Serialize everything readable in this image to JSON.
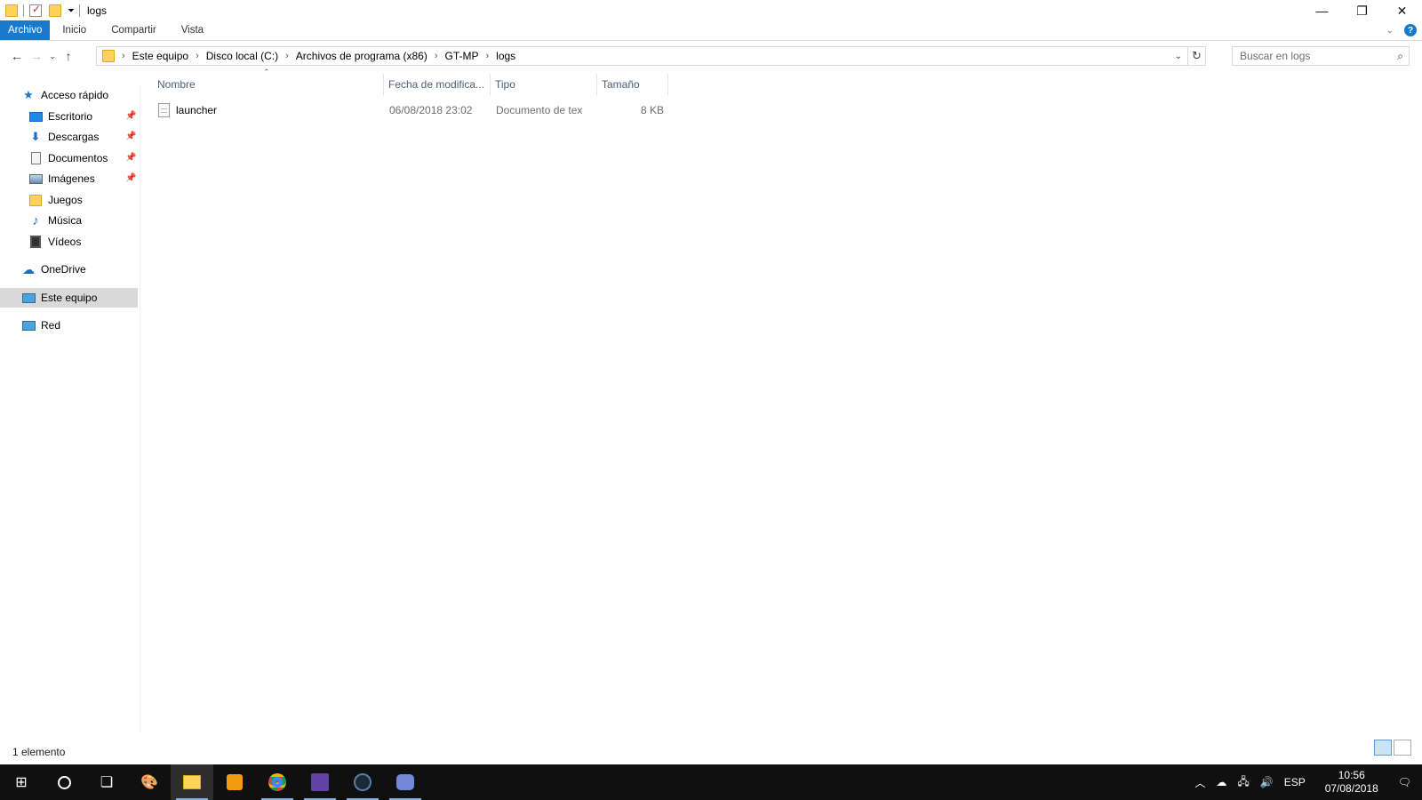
{
  "window": {
    "title": "logs",
    "controls": {
      "minimize": "—",
      "restore": "❐",
      "close": "✕"
    }
  },
  "ribbon": {
    "tabs": [
      "Archivo",
      "Inicio",
      "Compartir",
      "Vista"
    ],
    "accent": "#1979ca",
    "help_icon": "?"
  },
  "address_bar": {
    "breadcrumbs": [
      "Este equipo",
      "Disco local (C:)",
      "Archivos de programa (x86)",
      "GT-MP",
      "logs"
    ],
    "search_placeholder": "Buscar en logs"
  },
  "sidebar": {
    "items": [
      {
        "label": "Acceso rápido",
        "icon": "star-icon"
      },
      {
        "label": "Escritorio",
        "icon": "desktop-icon",
        "pinned": true
      },
      {
        "label": "Descargas",
        "icon": "download-icon",
        "pinned": true
      },
      {
        "label": "Documentos",
        "icon": "documents-icon",
        "pinned": true
      },
      {
        "label": "Imágenes",
        "icon": "pictures-icon",
        "pinned": true
      },
      {
        "label": "Juegos",
        "icon": "folder-icon"
      },
      {
        "label": "Música",
        "icon": "music-icon"
      },
      {
        "label": "Vídeos",
        "icon": "videos-icon"
      },
      {
        "label": "OneDrive",
        "icon": "cloud-icon"
      },
      {
        "label": "Este equipo",
        "icon": "computer-icon",
        "selected": true
      },
      {
        "label": "Red",
        "icon": "network-icon"
      }
    ]
  },
  "file_list": {
    "columns": [
      "Nombre",
      "Fecha de modifica...",
      "Tipo",
      "Tamaño"
    ],
    "rows": [
      {
        "name": "launcher",
        "date": "06/08/2018 23:02",
        "type": "Documento de tex",
        "size": "8 KB"
      }
    ]
  },
  "status_bar": {
    "count": "1 elemento"
  },
  "taskbar": {
    "apps": [
      "start-icon",
      "cortana-icon",
      "task-view-icon",
      "paint-icon",
      "file-explorer-icon",
      "media-player-icon",
      "chrome-icon",
      "twitch-icon",
      "steam-icon",
      "discord-icon"
    ],
    "language": "ESP",
    "time": "10:56",
    "date": "07/08/2018"
  }
}
